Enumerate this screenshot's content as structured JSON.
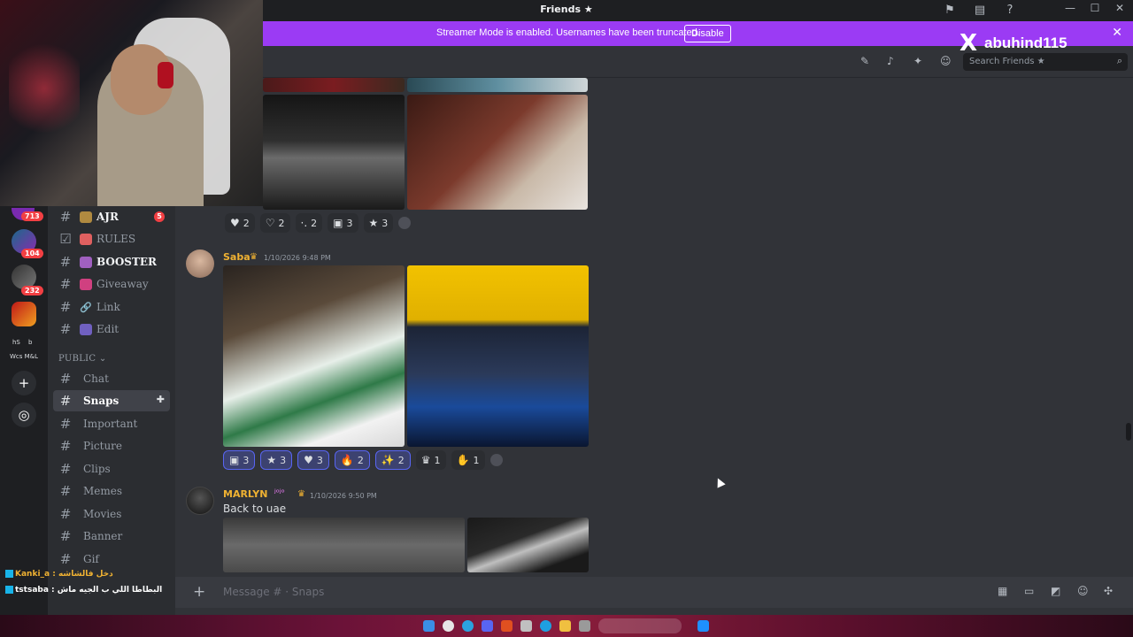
{
  "window": {
    "title": "Friends ★",
    "controls": [
      "—",
      "☐",
      "✕"
    ]
  },
  "streamer_banner": {
    "message": "Streamer Mode is enabled. Usernames have been truncated.",
    "button": "Disable",
    "close": "✕"
  },
  "overlay": {
    "x_logo": "X",
    "handle": "abuhind115"
  },
  "server_rail": {
    "badges": [
      "713",
      "104",
      "232"
    ],
    "text_a": "hS",
    "text_b": "b",
    "text_c": "Wcs M&L"
  },
  "channels": [
    {
      "label": "AJR",
      "bold": true,
      "count": "5"
    },
    {
      "label": "RULES",
      "bold": false
    },
    {
      "label": "BOOSTER",
      "bold": true
    },
    {
      "label": "Giveaway",
      "bold": false
    },
    {
      "label": "Link",
      "bold": false
    },
    {
      "label": "Edit",
      "bold": false
    }
  ],
  "category": "PUBLIC ⌄",
  "public_channels": [
    {
      "label": "Chat"
    },
    {
      "label": "Snaps",
      "active": true
    },
    {
      "label": "Important"
    },
    {
      "label": "Picture"
    },
    {
      "label": "Clips"
    },
    {
      "label": "Memes"
    },
    {
      "label": "Movies"
    },
    {
      "label": "Banner"
    },
    {
      "label": "Gif"
    }
  ],
  "search": {
    "placeholder": "Search Friends ★"
  },
  "messages": [
    {
      "reactions": [
        {
          "emoji": "♥",
          "count": "2"
        },
        {
          "emoji": "♡",
          "count": "2"
        },
        {
          "emoji": "·.",
          "count": "2"
        },
        {
          "emoji": "▣",
          "count": "3"
        },
        {
          "emoji": "★",
          "count": "3"
        }
      ]
    },
    {
      "author": "Saba",
      "crown": "♛",
      "timestamp": "1/10/2026 9:48 PM",
      "reactions": [
        {
          "emoji": "▣",
          "count": "3",
          "me": true
        },
        {
          "emoji": "★",
          "count": "3"
        },
        {
          "emoji": "♥",
          "count": "3"
        },
        {
          "emoji": "🔥",
          "count": "2"
        },
        {
          "emoji": "✨",
          "count": "2"
        },
        {
          "emoji": "♛",
          "count": "1"
        },
        {
          "emoji": "✋",
          "count": "1"
        }
      ]
    },
    {
      "author": "MARLYN",
      "tag": "ʲᵒʲᵒ",
      "crown": "♛",
      "timestamp": "1/10/2026 9:50 PM",
      "text": "Back to uae"
    }
  ],
  "composer": {
    "placeholder": "Message # · Snaps",
    "plus": "+"
  },
  "chat_overlay": {
    "line1": "Kanki_a : دخل فالشاشه",
    "line2": "tstsaba : البطاطا اللي ب الجيه ماش"
  },
  "colors": {
    "banner": "#9b3bf4",
    "accent": "#5865f2",
    "badge": "#f23f43",
    "saba": "#f0b232",
    "marlyn": "#f0b232"
  }
}
